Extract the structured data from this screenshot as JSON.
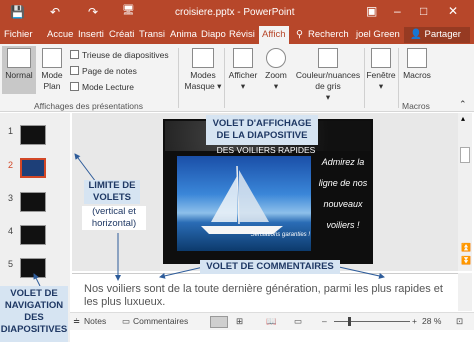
{
  "titlebar": {
    "title": "croisiere.pptx - PowerPoint",
    "qat": {
      "save": "💾",
      "undo": "↶",
      "redo": "↷",
      "present": "🖥"
    },
    "controls": {
      "options": "▣",
      "minimize": "–",
      "maximize": "□",
      "close": "✕"
    }
  },
  "tabs": [
    "Fichier",
    "Accue",
    "Inserti",
    "Créati",
    "Transi",
    "Anima",
    "Diapo",
    "Révisi",
    "Affich"
  ],
  "active_tab": "Affich",
  "tab_extra": {
    "search": "Recherch",
    "user": "joel Green",
    "share": "Partager"
  },
  "ribbon": {
    "normal": "Normal",
    "mode_plan": "Mode Plan",
    "trieuse": "Trieuse de diapositives",
    "page_notes": "Page de notes",
    "mode_lecture": "Mode Lecture",
    "group_views": "Affichages des présentations",
    "modes_masque": "Modes Masque",
    "afficher": "Afficher",
    "zoom": "Zoom",
    "couleur": "Couleur/nuances de gris",
    "fenetre": "Fenêtre",
    "macros": "Macros",
    "group_macros": "Macros"
  },
  "slides": [
    {
      "num": "1"
    },
    {
      "num": "2"
    },
    {
      "num": "3"
    },
    {
      "num": "4"
    },
    {
      "num": "5"
    }
  ],
  "slide": {
    "subtitle": "DES VOILIERS RAPIDES",
    "right_text": "Admirez la ligne de nos nouveaux voiliers !",
    "photo_caption": "Sensations garanties !"
  },
  "notes_text": "Nos voiliers sont de la toute dernière génération, parmi les plus rapides et les plus luxueux.",
  "status": {
    "notes": "Notes",
    "comments": "Commentaires",
    "zoom": "28 %"
  },
  "callouts": {
    "slide_view": "VOLET D'AFFICHAGE DE LA DIAPOSITIVE",
    "limit": "LIMITE DE VOLETS",
    "limit_detail": "(vertical et horizontal)",
    "comments_pane": "VOLET DE COMMENTAIRES",
    "nav_pane": "VOLET DE NAVIGATION DES DIAPOSITIVES"
  }
}
